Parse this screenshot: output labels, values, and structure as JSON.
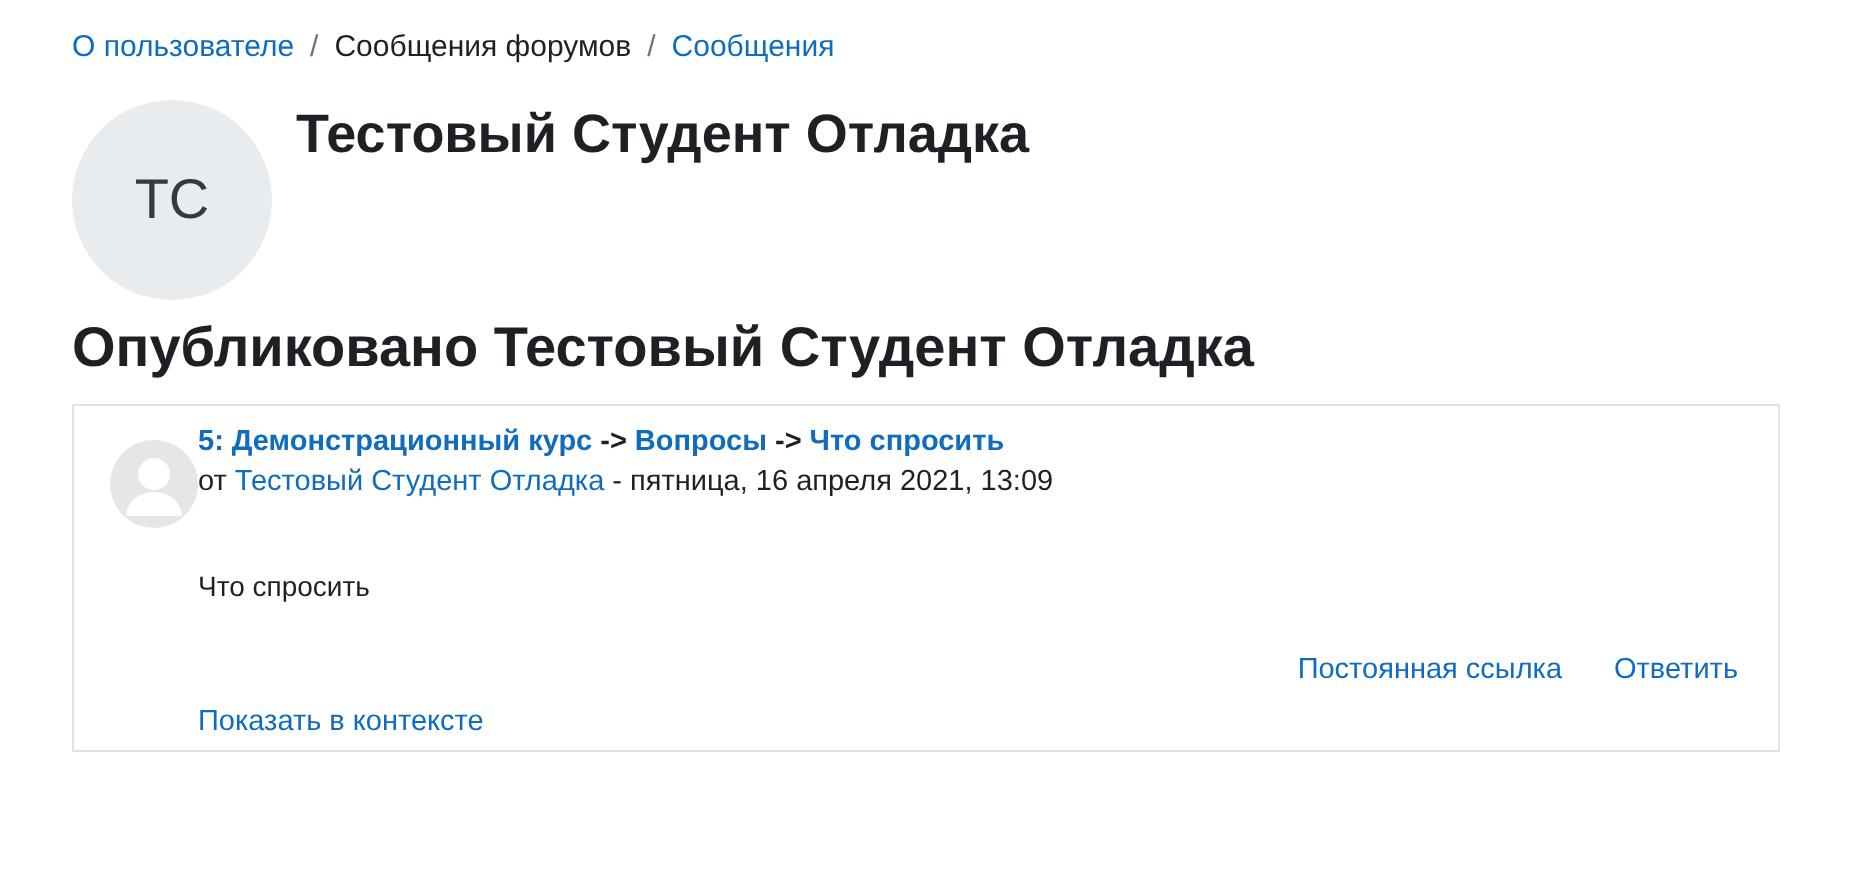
{
  "breadcrumb": {
    "separator": "/",
    "items": [
      {
        "label": "О пользователе",
        "link": true
      },
      {
        "label": "Сообщения форумов",
        "link": false
      },
      {
        "label": "Сообщения",
        "link": true
      }
    ]
  },
  "profile": {
    "initials": "ТС",
    "name": "Тестовый Студент Отладка"
  },
  "heading": "Опубликовано Тестовый Студент Отладка",
  "post": {
    "subject": [
      {
        "text": "5: Демонстрационный курс",
        "link": true
      },
      {
        "text": "->",
        "link": false
      },
      {
        "text": "Вопросы",
        "link": true
      },
      {
        "text": "->",
        "link": false
      },
      {
        "text": "Что спросить",
        "link": true
      }
    ],
    "by": "от",
    "author": "Тестовый Студент Отладка",
    "date": "- пятница, 16 апреля 2021, 13:09",
    "message": "Что спросить",
    "actions": [
      "Постоянная ссылка",
      "Ответить"
    ],
    "context_link": "Показать в контексте"
  }
}
